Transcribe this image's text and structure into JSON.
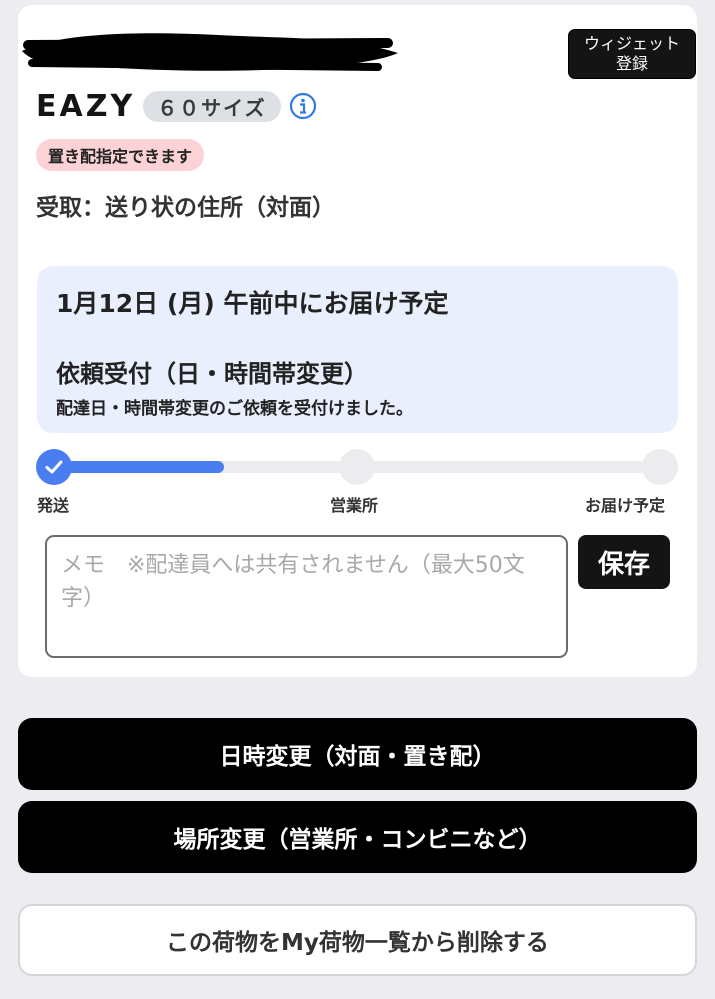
{
  "header": {
    "widget_button_label": "ウィジェット\n登録"
  },
  "package": {
    "brand": "EAZY",
    "size_label": "６０サイズ",
    "info_icon": "info-circle-icon",
    "okihai_badge": "置き配指定できます",
    "receive_text": "受取：送り状の住所（対面）"
  },
  "status": {
    "delivery_date": "1月12日 (月) 午前中にお届け予定",
    "request_title": "依頼受付（日・時間帯変更）",
    "request_desc": "配達日・時間帯変更のご依頼を受付けました。"
  },
  "progress": {
    "fill_fraction": 0.28,
    "steps": [
      {
        "label": "発送",
        "done": true,
        "icon": "check-icon"
      },
      {
        "label": "営業所",
        "done": false
      },
      {
        "label": "お届け予定",
        "done": false
      }
    ]
  },
  "memo": {
    "placeholder": "メモ　※配達員へは共有されません（最大50文字）",
    "value": "",
    "save_label": "保存"
  },
  "actions": {
    "change_datetime_label": "日時変更（対面・置き配）",
    "change_place_label": "場所変更（営業所・コンビニなど）",
    "delete_label": "この荷物をMy荷物一覧から削除する"
  },
  "colors": {
    "accent": "#4a7ef0",
    "status_bg": "#e9effc",
    "okihai_bg": "#fbd3d6",
    "button_dark": "#000000",
    "page_bg": "#ececf1"
  }
}
